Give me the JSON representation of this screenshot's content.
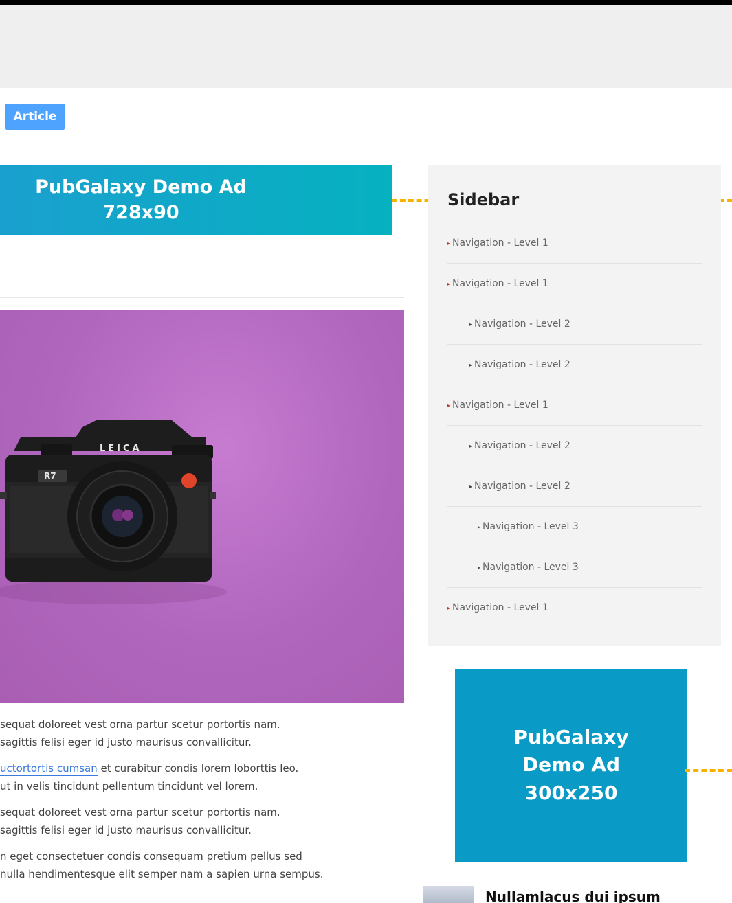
{
  "tag": {
    "label": "Article"
  },
  "ads": {
    "top_line1": "PubGalaxy Demo Ad",
    "top_line2": "728x90",
    "side_line1": "PubGalaxy",
    "side_line2": "Demo Ad",
    "side_line3": "300x250"
  },
  "sidebar": {
    "title": "Sidebar",
    "items": [
      {
        "label": "Navigation - Level 1",
        "level": 1
      },
      {
        "label": "Navigation - Level 1",
        "level": 1
      },
      {
        "label": "Navigation - Level 2",
        "level": 2
      },
      {
        "label": "Navigation - Level 2",
        "level": 2
      },
      {
        "label": "Navigation - Level 1",
        "level": 1
      },
      {
        "label": "Navigation - Level 2",
        "level": 2
      },
      {
        "label": "Navigation - Level 2",
        "level": 2
      },
      {
        "label": "Navigation - Level 3",
        "level": 3
      },
      {
        "label": "Navigation - Level 3",
        "level": 3
      },
      {
        "label": "Navigation - Level 1",
        "level": 1
      }
    ]
  },
  "article": {
    "p1_line1": "sequat doloreet vest orna partur scetur portortis nam.",
    "p1_line2": "sagittis felisi eger id justo maurisus convallicitur.",
    "p2_link": "uctortortis cumsan",
    "p2_line1_rest": " et curabitur condis lorem loborttis leo.",
    "p2_line2": "ut in velis tincidunt pellentum tincidunt vel lorem.",
    "p3_line1": "sequat doloreet vest orna partur scetur portortis nam.",
    "p3_line2": "sagittis felisi eger id justo maurisus convallicitur.",
    "p4_line1": "n eget consectetuer condis consequam pretium pellus sed",
    "p4_line2": "nulla hendimentesque elit semper nam a sapien urna sempus."
  },
  "hero_image": {
    "camera_brand": "LEICA",
    "model": "R7"
  },
  "recent_post": {
    "title": "Nullamlacus dui ipsum"
  }
}
